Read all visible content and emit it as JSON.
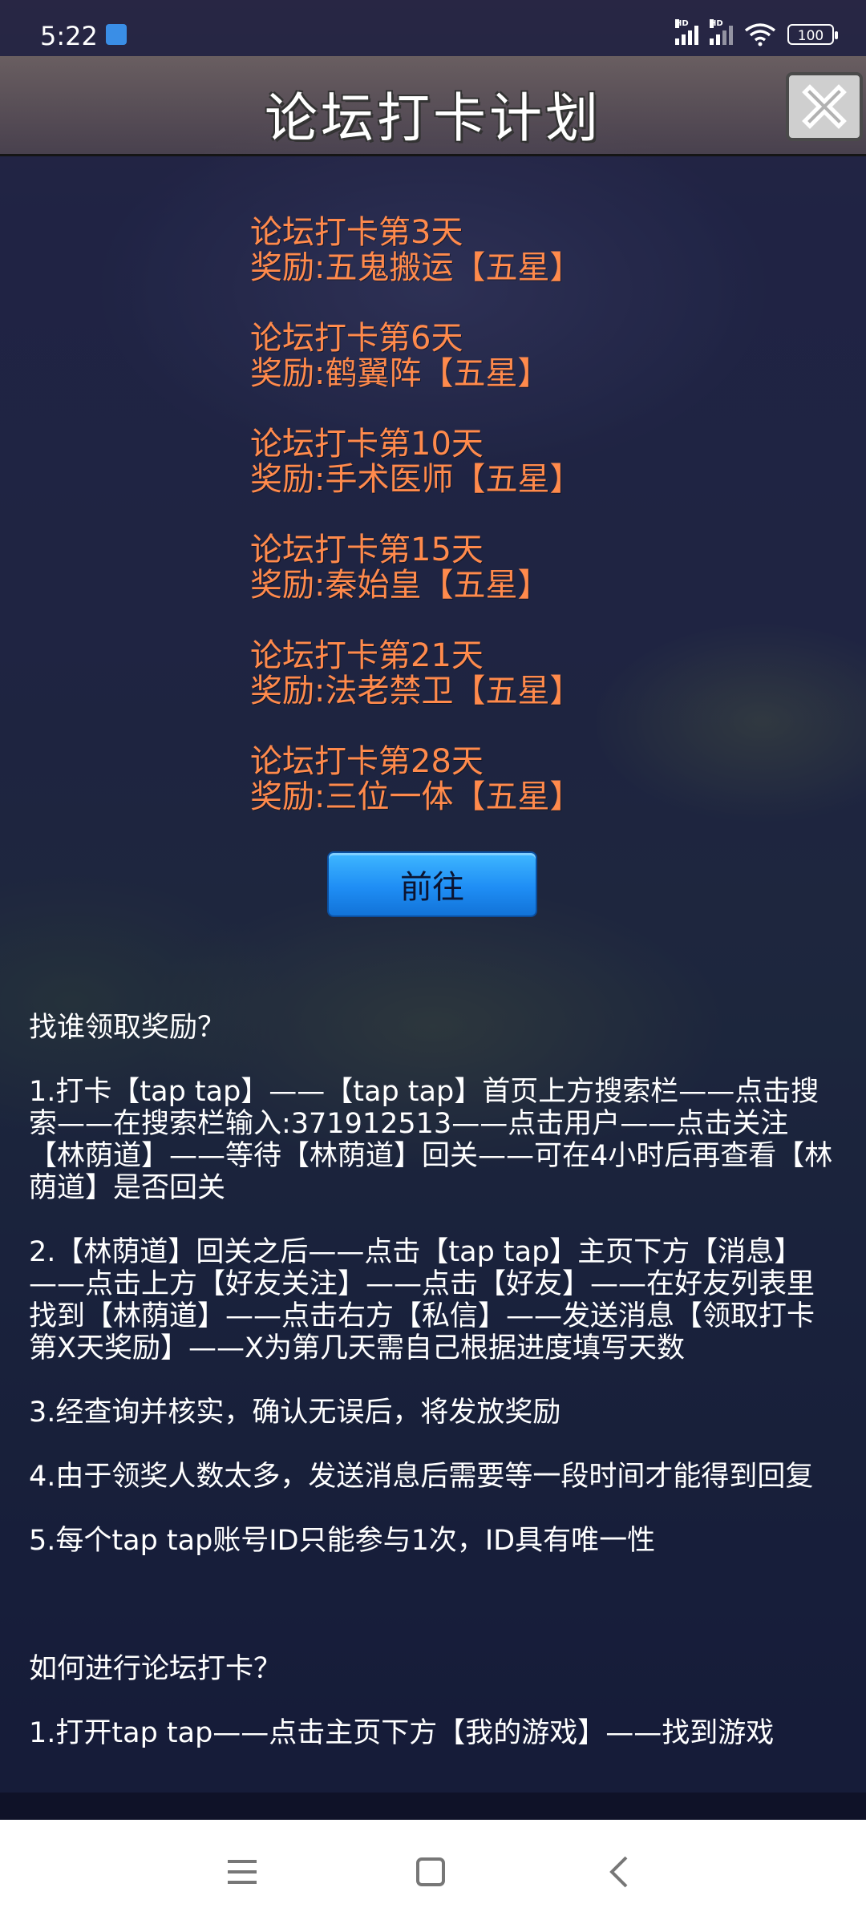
{
  "status_bar": {
    "time": "5:22",
    "battery": "100",
    "network_label_1": "HD",
    "network_label_2": "HD"
  },
  "header": {
    "title": "论坛打卡计划",
    "close_icon": "close-x-icon"
  },
  "rewards": [
    {
      "day": "论坛打卡第3天",
      "reward": "奖励:五鬼搬运【五星】"
    },
    {
      "day": "论坛打卡第6天",
      "reward": "奖励:鹤翼阵【五星】"
    },
    {
      "day": "论坛打卡第10天",
      "reward": "奖励:手术医师【五星】"
    },
    {
      "day": "论坛打卡第15天",
      "reward": "奖励:秦始皇【五星】"
    },
    {
      "day": "论坛打卡第21天",
      "reward": "奖励:法老禁卫【五星】"
    },
    {
      "day": "论坛打卡第28天",
      "reward": "奖励:三位一体【五星】"
    }
  ],
  "go_button": {
    "label": "前往"
  },
  "instructions": {
    "heading": "找谁领取奖励？",
    "steps": [
      "1.打卡【tap tap】——【tap tap】首页上方搜索栏——点击搜索——在搜索栏输入:371912513——点击用户——点击关注【林荫道】——等待【林荫道】回关——可在4小时后再查看【林荫道】是否回关",
      "2.【林荫道】回关之后——点击【tap tap】主页下方【消息】——点击上方【好友关注】——点击【好友】——在好友列表里找到【林荫道】——点击右方【私信】——发送消息【领取打卡第X天奖励】——X为第几天需自己根据进度填写天数",
      "3.经查询并核实，确认无误后，将发放奖励",
      "4.由于领奖人数太多，发送消息后需要等一段时间才能得到回复",
      "5.每个tap tap账号ID只能参与1次，ID具有唯一性"
    ],
    "heading_2": "如何进行论坛打卡？",
    "partial_line": "1.打开tap tap——点击主页下方【我的游戏】——找到游戏"
  },
  "colors": {
    "reward_text": "#ff8a4c",
    "button_blue": "#1f8ef5",
    "instruction_text": "#ffffff"
  },
  "nav_bar": {
    "menu_icon": "menu-icon",
    "home_icon": "home-square-icon",
    "back_icon": "back-chevron-icon"
  }
}
